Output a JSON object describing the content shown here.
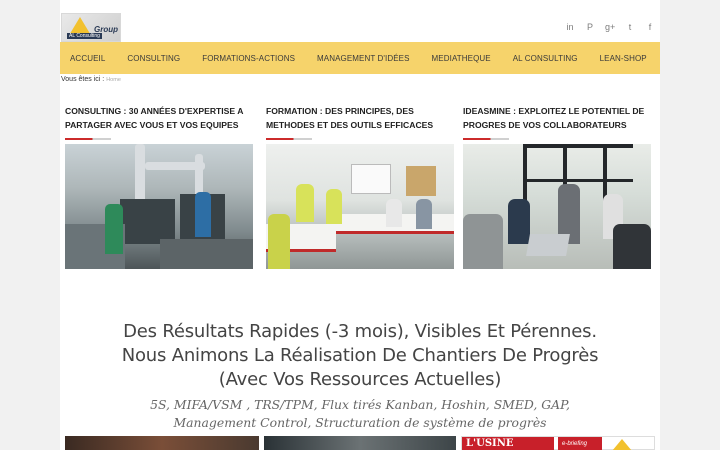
{
  "logo": {
    "brand": "Group",
    "sub": "AL Consulting"
  },
  "social": {
    "linkedin": "in",
    "pinterest": "P",
    "googleplus": "g+",
    "twitter": "t",
    "facebook": "f"
  },
  "nav": {
    "items": [
      "ACCUEIL",
      "CONSULTING",
      "FORMATIONS-ACTIONS",
      "MANAGEMENT D'IDÉES",
      "MEDIATHEQUE",
      "AL CONSULTING",
      "LEAN-SHOP"
    ]
  },
  "breadcrumb": {
    "label": "Vous êtes ici :",
    "home": "Home"
  },
  "columns": [
    {
      "title": "CONSULTING : 30 ANNÉES D'EXPERTISE A PARTAGER AVEC VOUS ET VOS EQUIPES"
    },
    {
      "title": "FORMATION : DES PRINCIPES, DES METHODES ET DES OUTILS EFFICACES"
    },
    {
      "title": "IDEASMINE : EXPLOITEZ LE POTENTIEL DE PROGRES DE VOS COLLABORATEURS"
    }
  ],
  "tagline": {
    "line1": "Des Résultats Rapides (-3 mois), Visibles Et Pérennes.",
    "line2": "Nous Animons La Réalisation De Chantiers De Progrès",
    "line3": "(Avec Vos Ressources Actuelles)"
  },
  "keywords": {
    "line1": "5S, MIFA/VSM , TRS/TPM, Flux tirés Kanban, Hoshin, SMED, GAP,",
    "line2": "Management Control, Structuration de système de progrès"
  },
  "bottom": {
    "press": "L'USINE",
    "briefing": "e-briefing"
  },
  "colors": {
    "nav_bg": "#f6d36b",
    "accent_red": "#cc2b2b",
    "page_bg": "#f1f1f1"
  }
}
